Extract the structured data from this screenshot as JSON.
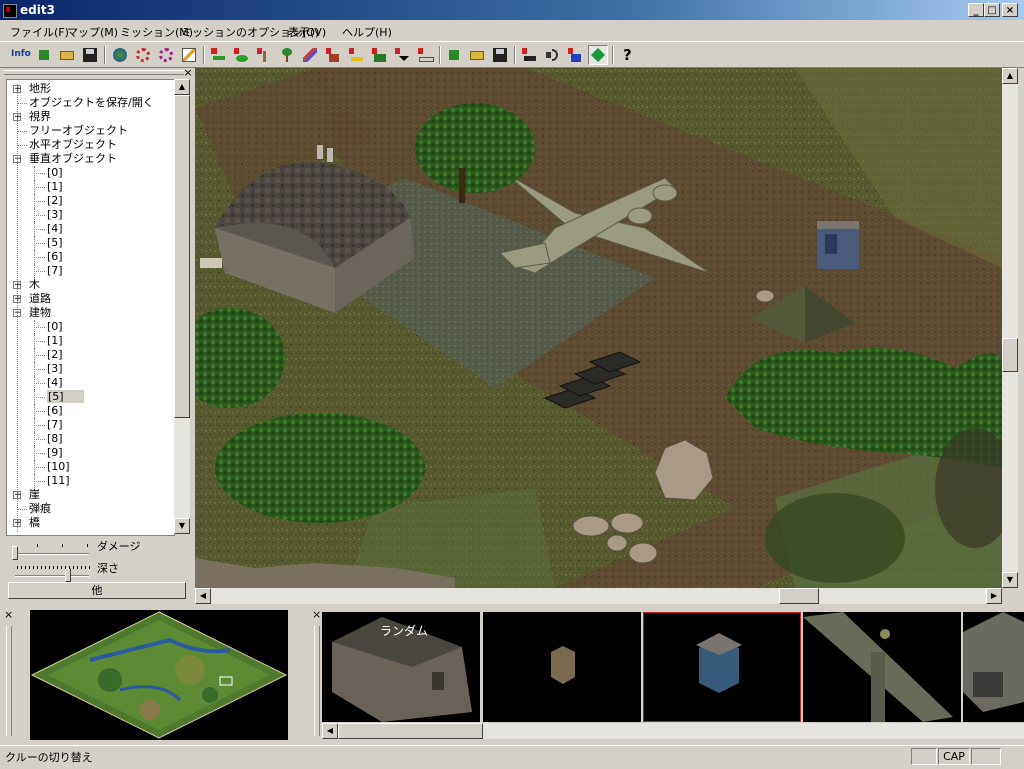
{
  "window": {
    "title": "edit3"
  },
  "menu": [
    {
      "label": "ファイル(F)"
    },
    {
      "label": "マップ(M)"
    },
    {
      "label": "ミッション(M)"
    },
    {
      "label": "ミッションのオプション(O)"
    },
    {
      "label": "表示(V)"
    },
    {
      "label": "ヘルプ(H)"
    }
  ],
  "toolbar": {
    "info_label": "Info",
    "icons": [
      "info-icon",
      "new-icon",
      "open-icon",
      "save-icon",
      "globe-icon",
      "gear-icon",
      "gear2-icon",
      "pencil-icon",
      "tool-n-icon",
      "tool-l-icon",
      "tool-s-icon",
      "tool-tree-icon",
      "tool-feather-icon",
      "tool-h-icon",
      "tool-f-icon",
      "tool-c-icon",
      "tool-v-icon",
      "tool-b-icon",
      "new-mission-icon",
      "open-mission-icon",
      "save-mission-icon",
      "unit-icon",
      "sound-icon",
      "zone-icon",
      "diamond-icon",
      "help-icon"
    ]
  },
  "tree": {
    "items": [
      {
        "label": "地形",
        "level": 0,
        "expander": "+"
      },
      {
        "label": "オブジェクトを保存/開く",
        "level": 0,
        "expander": ""
      },
      {
        "label": "視界",
        "level": 0,
        "expander": "+"
      },
      {
        "label": "フリーオブジェクト",
        "level": 0,
        "expander": ""
      },
      {
        "label": "水平オブジェクト",
        "level": 0,
        "expander": ""
      },
      {
        "label": "垂直オブジェクト",
        "level": 0,
        "expander": "-"
      },
      {
        "label": "[0]",
        "level": 1
      },
      {
        "label": "[1]",
        "level": 1
      },
      {
        "label": "[2]",
        "level": 1
      },
      {
        "label": "[3]",
        "level": 1
      },
      {
        "label": "[4]",
        "level": 1
      },
      {
        "label": "[5]",
        "level": 1
      },
      {
        "label": "[6]",
        "level": 1
      },
      {
        "label": "[7]",
        "level": 1
      },
      {
        "label": "木",
        "level": 0,
        "expander": "+"
      },
      {
        "label": "道路",
        "level": 0,
        "expander": "+"
      },
      {
        "label": "建物",
        "level": 0,
        "expander": "-"
      },
      {
        "label": "[0]",
        "level": 1
      },
      {
        "label": "[1]",
        "level": 1
      },
      {
        "label": "[2]",
        "level": 1
      },
      {
        "label": "[3]",
        "level": 1
      },
      {
        "label": "[4]",
        "level": 1
      },
      {
        "label": "[5]",
        "level": 1,
        "selected": true
      },
      {
        "label": "[6]",
        "level": 1
      },
      {
        "label": "[7]",
        "level": 1
      },
      {
        "label": "[8]",
        "level": 1
      },
      {
        "label": "[9]",
        "level": 1
      },
      {
        "label": "[10]",
        "level": 1
      },
      {
        "label": "[11]",
        "level": 1
      },
      {
        "label": "崖",
        "level": 0,
        "expander": "+"
      },
      {
        "label": "弾痕",
        "level": 0,
        "expander": ""
      },
      {
        "label": "橋",
        "level": 0,
        "expander": "+"
      }
    ]
  },
  "controls": {
    "damage_label": "ダメージ",
    "depth_label": "深さ",
    "other_button": "他",
    "damage_level": 0.0,
    "depth_level": 0.72
  },
  "thumbnails": {
    "first_label": "ランダム"
  },
  "status": {
    "text": "クルーの切り替え",
    "cap": "CAP"
  },
  "colors": {
    "title_start": "#0a246a",
    "title_end": "#a6caf0",
    "selected_thumb_border": "#c02020"
  }
}
